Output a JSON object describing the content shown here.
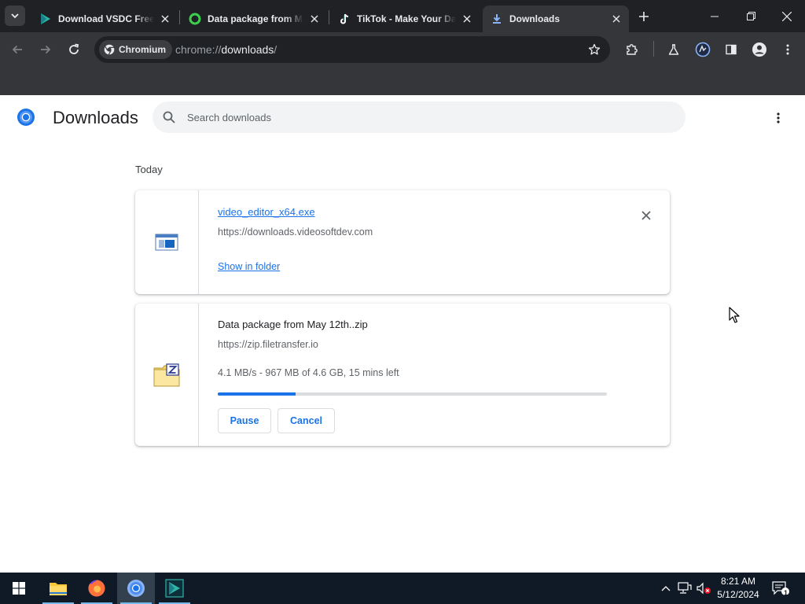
{
  "browser": {
    "tabs": [
      {
        "title": "Download VSDC Free",
        "icon": "vsdc-icon",
        "active": false
      },
      {
        "title": "Data package from May",
        "icon": "filetransfer-icon",
        "active": false
      },
      {
        "title": "TikTok - Make Your Day",
        "icon": "tiktok-icon",
        "active": false
      },
      {
        "title": "Downloads",
        "icon": "download-icon",
        "active": true
      }
    ],
    "omnibox": {
      "chip_label": "Chromium",
      "url_scheme": "chrome://",
      "url_host": "downloads",
      "url_rest": "/"
    }
  },
  "page": {
    "title": "Downloads",
    "search_placeholder": "Search downloads",
    "section": "Today",
    "downloads": [
      {
        "filename": "video_editor_x64.exe",
        "source": "https://downloads.videosoftdev.com",
        "action": "Show in folder",
        "icon": "exe-file-icon",
        "completed": true
      },
      {
        "filename": "Data package from May 12th..zip",
        "source": "https://zip.filetransfer.io",
        "status": "4.1 MB/s - 967 MB of 4.6 GB, 15 mins left",
        "progress": 0.2,
        "pause_label": "Pause",
        "cancel_label": "Cancel",
        "icon": "zip-file-icon",
        "completed": false
      }
    ]
  },
  "taskbar": {
    "apps": [
      "start-icon",
      "file-explorer-icon",
      "firefox-icon",
      "chromium-icon",
      "vsdc-icon"
    ],
    "time": "8:21 AM",
    "date": "5/12/2024",
    "notification_count": "1"
  },
  "colors": {
    "accent": "#1a73e8",
    "tabstrip": "#202124",
    "toolbar": "#35363a",
    "taskbar": "#0f1a26"
  }
}
